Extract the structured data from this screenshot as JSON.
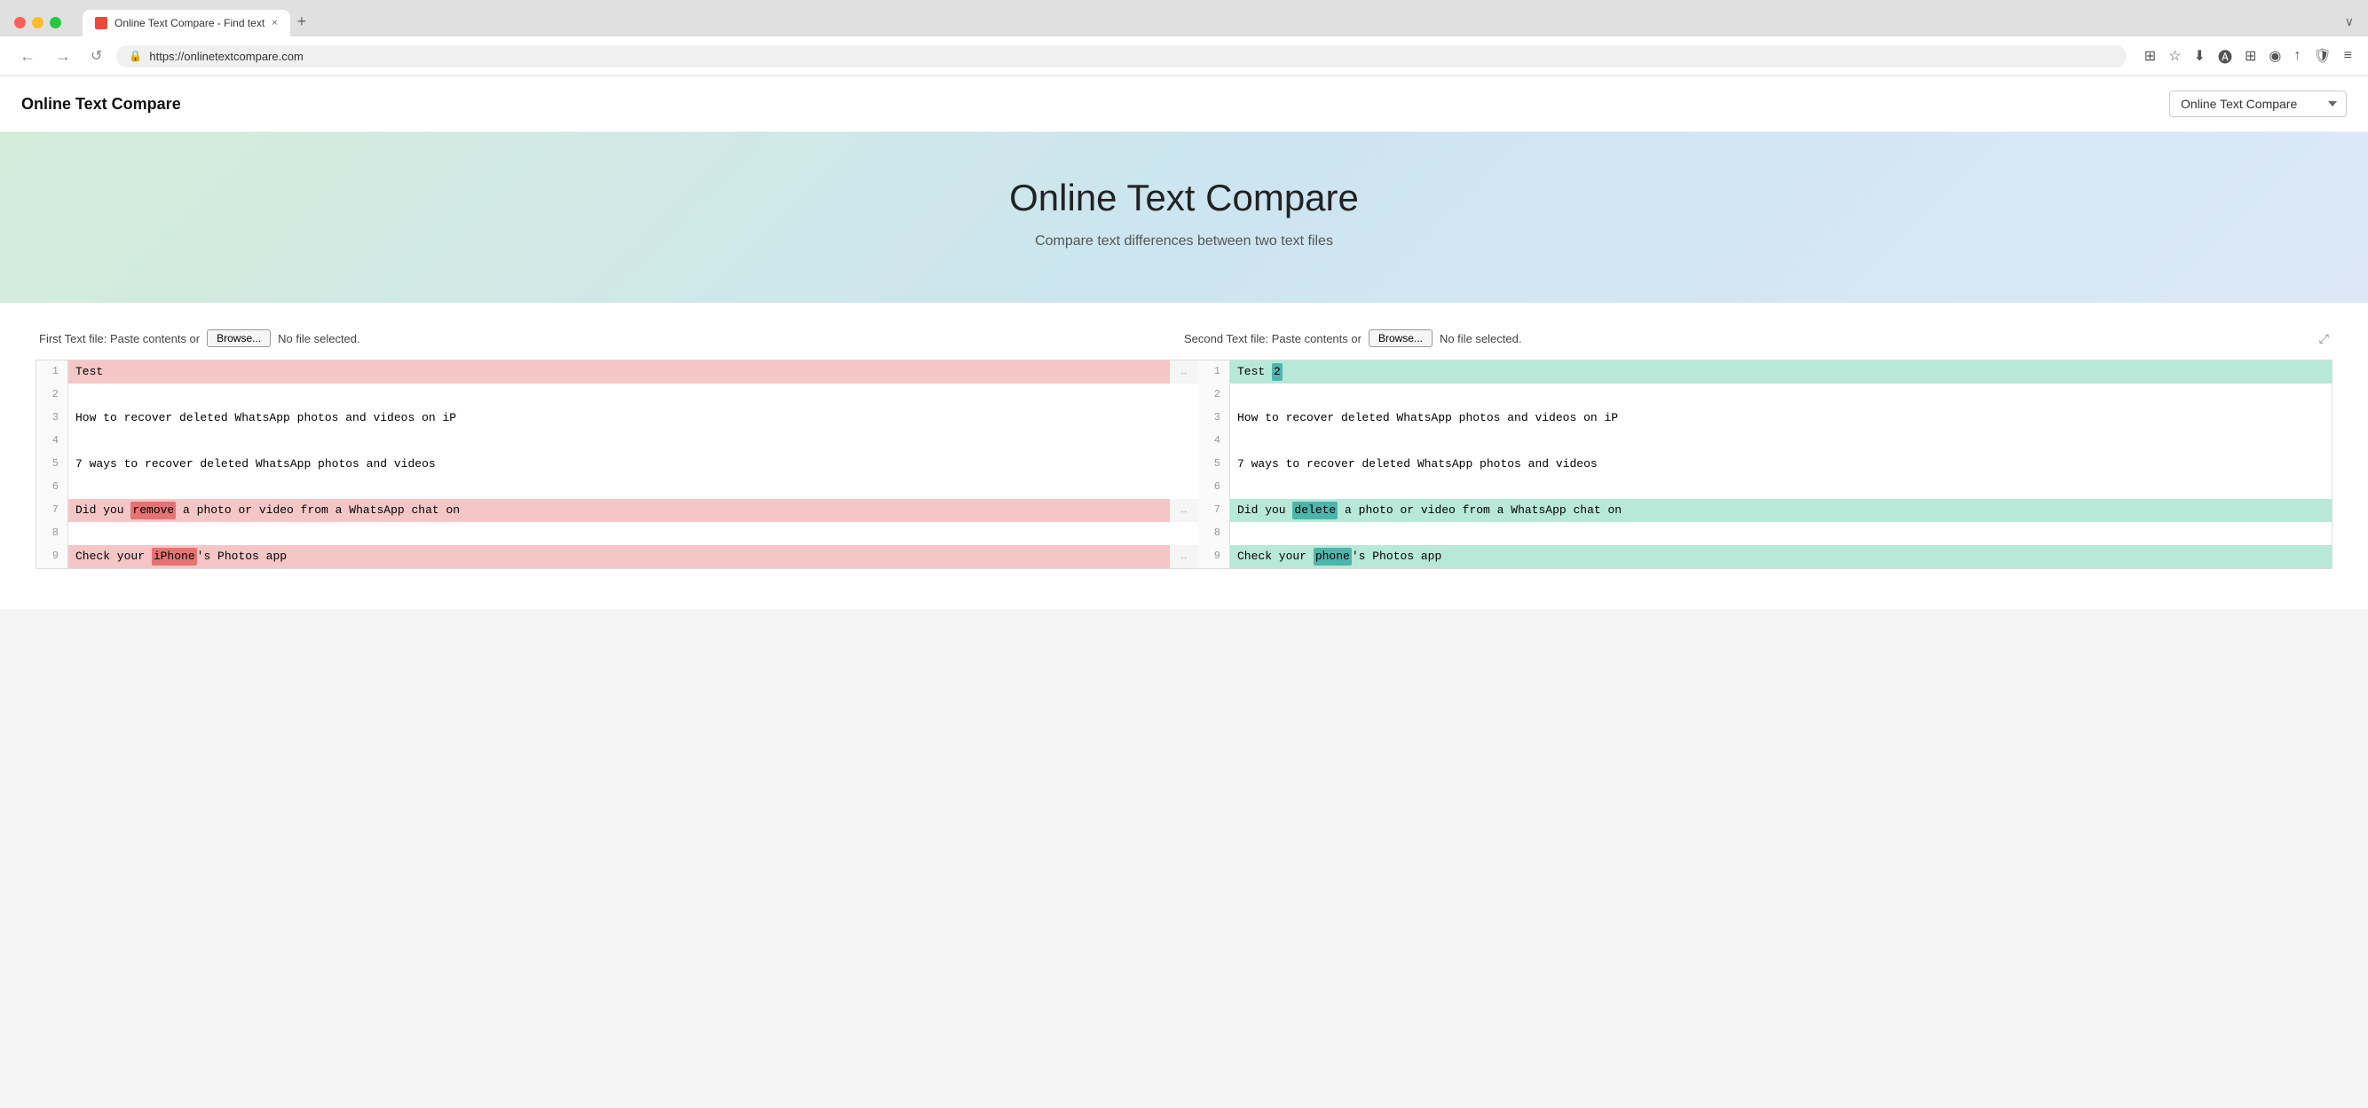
{
  "browser": {
    "traffic_lights": [
      "red",
      "yellow",
      "green"
    ],
    "tab_title": "Online Text Compare - Find text",
    "tab_favicon_alt": "site-favicon",
    "tab_close": "×",
    "tab_add": "+",
    "tab_chevron": "∨",
    "url": "https://onlinetextcompare.com",
    "nav_back": "←",
    "nav_forward": "→",
    "nav_refresh": "↺",
    "nav_icons": [
      "🛡",
      "🔒",
      "⊞",
      "☆",
      "⊞",
      "◯",
      "↑",
      "🛡",
      "≡"
    ]
  },
  "site": {
    "title": "Online Text Compare",
    "nav_dropdown_label": "Online Text Compare",
    "nav_dropdown_options": [
      "Online Text Compare"
    ]
  },
  "hero": {
    "title": "Online Text Compare",
    "subtitle": "Compare text differences between two text files"
  },
  "compare": {
    "left_panel": {
      "label": "First Text file: Paste contents or",
      "browse_label": "Browse...",
      "file_status": "No file selected."
    },
    "right_panel": {
      "label": "Second Text file: Paste contents or",
      "browse_label": "Browse...",
      "file_status": "No file selected.",
      "expand_icon": "⤢"
    },
    "left_lines": [
      {
        "num": "1",
        "content": "Test",
        "type": "removed",
        "inline": [
          {
            "text": "Test",
            "mark": false
          }
        ]
      },
      {
        "num": "2",
        "content": "",
        "type": "normal"
      },
      {
        "num": "3",
        "content": "How to recover deleted WhatsApp photos and videos on iP",
        "type": "normal"
      },
      {
        "num": "4",
        "content": "",
        "type": "normal"
      },
      {
        "num": "5",
        "content": "7 ways to recover deleted WhatsApp photos and videos",
        "type": "normal"
      },
      {
        "num": "6",
        "content": "",
        "type": "normal"
      },
      {
        "num": "7",
        "content": "Did you ",
        "content_parts": [
          {
            "text": "Did you ",
            "mark": false
          },
          {
            "text": "remove",
            "mark": "inline-changed-left"
          },
          {
            "text": " a photo or video from a WhatsApp chat on",
            "mark": false
          }
        ],
        "type": "removed"
      },
      {
        "num": "8",
        "content": "",
        "type": "normal"
      },
      {
        "num": "9",
        "content_parts": [
          {
            "text": "Check your ",
            "mark": false
          },
          {
            "text": "iPhone",
            "mark": "inline-changed-left"
          },
          {
            "text": "'s Photos app",
            "mark": false
          }
        ],
        "type": "removed"
      }
    ],
    "right_lines": [
      {
        "num": "1",
        "content_parts": [
          {
            "text": "Test ",
            "mark": false
          },
          {
            "text": "2",
            "mark": "inline-changed-right"
          }
        ],
        "type": "added"
      },
      {
        "num": "2",
        "content": "",
        "type": "normal"
      },
      {
        "num": "3",
        "content": "How to recover deleted WhatsApp photos and videos on iP",
        "type": "normal"
      },
      {
        "num": "4",
        "content": "",
        "type": "normal"
      },
      {
        "num": "5",
        "content": "7 ways to recover deleted WhatsApp photos and videos",
        "type": "normal"
      },
      {
        "num": "6",
        "content": "",
        "type": "normal"
      },
      {
        "num": "7",
        "content_parts": [
          {
            "text": "Did you ",
            "mark": false
          },
          {
            "text": "delete",
            "mark": "inline-changed-right"
          },
          {
            "text": " a photo or video from a WhatsApp chat on",
            "mark": false
          }
        ],
        "type": "added"
      },
      {
        "num": "8",
        "content": "",
        "type": "normal"
      },
      {
        "num": "9",
        "content_parts": [
          {
            "text": "Check your ",
            "mark": false
          },
          {
            "text": "phone",
            "mark": "inline-changed-right"
          },
          {
            "text": "'s Photos app",
            "mark": false
          }
        ],
        "type": "added"
      }
    ],
    "sync_arrows": {
      "row1": "↔",
      "row7": "↔",
      "row9": "↔"
    }
  }
}
